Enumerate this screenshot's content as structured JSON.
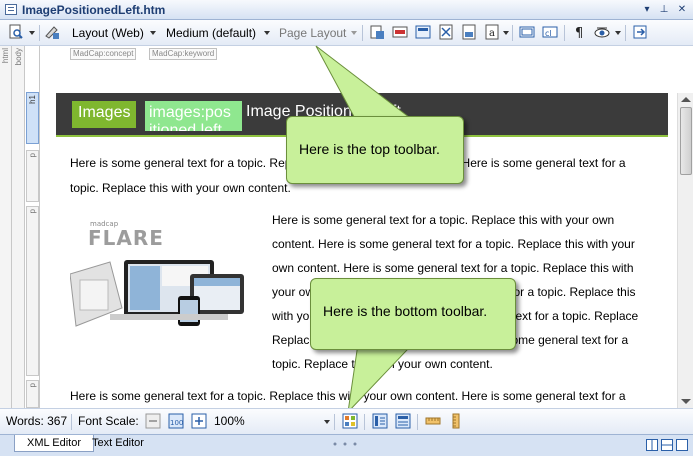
{
  "window": {
    "title": "ImagePositionedLeft.htm",
    "pin_glyph": "⊥",
    "close_glyph": "✕",
    "dropdown_glyph": "▾"
  },
  "toolbar": {
    "layout_label": "Layout (Web)",
    "medium_label": "Medium (default)",
    "page_layout_label": "Page Layout"
  },
  "meta_tags": [
    "MadCap:concept",
    "MadCap:keyword"
  ],
  "structure_tags": {
    "html": "html",
    "body": "body",
    "h1": "h1",
    "p": "p"
  },
  "document": {
    "banner_images": "Images",
    "banner_pos": "images:pos itioned left",
    "banner_title": "Image Positioned Left",
    "para1_line1": "Here is some general text for a topic. Replace this with your own content. Here is some general text for a",
    "para1_line2": "topic. Replace this with your own content.",
    "image_brand_small": "madcap",
    "image_brand": "FLARE",
    "para2_lines": [
      "Here is some general text for a topic. Replace this with your own",
      "content. Here is some general text for a topic. Replace this with your",
      "own content. Here is some general text for a topic. Replace this with",
      "your own content. Here is some general text for a topic. Replace this",
      "with your own content. Here is some general text for a topic. Replace",
      "Replace this with your own content. Here is some general text for a",
      "topic. Replace this with your own content."
    ],
    "para3_line1": "Here is some general text for a topic. Replace this with your own content. Here is some general text for a"
  },
  "callouts": {
    "top": "Here is the top toolbar.",
    "bottom": "Here is the bottom toolbar."
  },
  "bottombar": {
    "words_label": "Words: 367",
    "font_scale_label": "Font Scale:",
    "zoom_value": "100%"
  },
  "tabs": [
    {
      "label": "XML Editor"
    },
    {
      "label": "Text Editor"
    }
  ],
  "colors": {
    "banner_bg": "#3b3b3b",
    "banner_accent": "#7fb72f",
    "callout_fill": "#c8f09a",
    "title_text": "#1e3e73"
  }
}
